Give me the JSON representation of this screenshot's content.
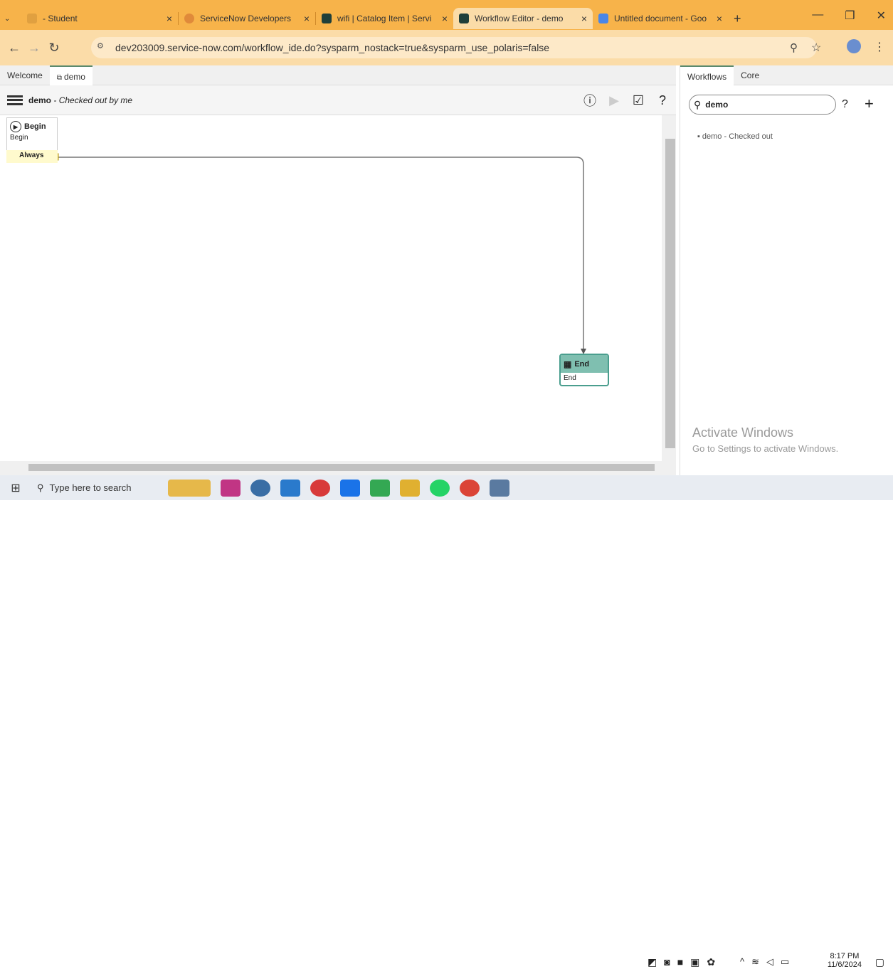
{
  "browser": {
    "tabs": [
      {
        "label": "- Student",
        "active": false
      },
      {
        "label": "ServiceNow Developers",
        "active": false
      },
      {
        "label": "wifi | Catalog Item | Servi",
        "active": false
      },
      {
        "label": "Workflow Editor - demo",
        "active": true
      },
      {
        "label": "Untitled document - Goo",
        "active": false
      }
    ],
    "close_glyph": "×",
    "new_tab_glyph": "+",
    "url": "dev203009.service-now.com/workflow_ide.do?sysparm_nostack=true&sysparm_use_polaris=false"
  },
  "editor": {
    "tabs": [
      "Welcome",
      "demo"
    ],
    "title": "demo",
    "subtitle": "- Checked out by me"
  },
  "nodes": {
    "begin": {
      "title": "Begin",
      "body": "Begin",
      "condition": "Always"
    },
    "end": {
      "title": "End",
      "body": "End"
    }
  },
  "right_panel": {
    "tabs": [
      "Workflows",
      "Core"
    ],
    "search_value": "demo",
    "result": "demo - Checked out"
  },
  "watermark": {
    "line1": "Activate Windows",
    "line2": "Go to Settings to activate Windows."
  },
  "taskbar": {
    "search_placeholder": "Type here to search",
    "time": "8:17 PM",
    "date": "11/6/2024"
  }
}
